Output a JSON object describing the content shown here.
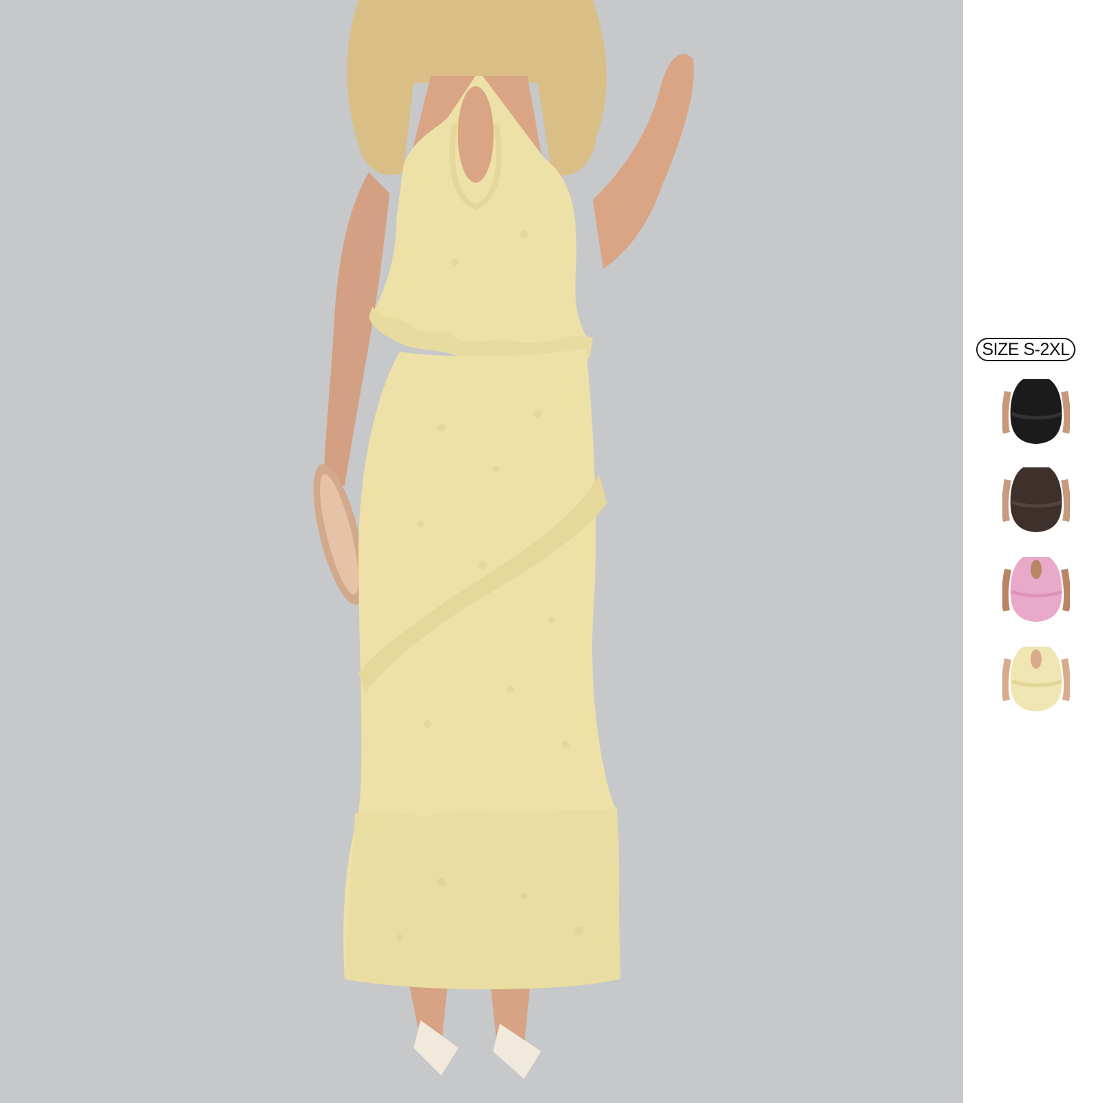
{
  "product": {
    "size_badge": "SIZE S-2XL",
    "main_color": "#ede1a8",
    "background_color": "#c7c8ca"
  },
  "swatches": [
    {
      "name": "black",
      "color": "#1b1b1b",
      "skin": "#c9987a"
    },
    {
      "name": "brown",
      "color": "#3e302b",
      "skin": "#c59a7e"
    },
    {
      "name": "pink",
      "color": "#e9a9c9",
      "skin": "#b98565"
    },
    {
      "name": "cream",
      "color": "#efe6b3",
      "skin": "#d8ab8d"
    }
  ]
}
